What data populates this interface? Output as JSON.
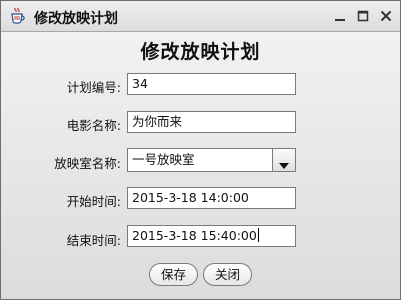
{
  "window": {
    "title": "修改放映计划"
  },
  "heading": "修改放映计划",
  "form": {
    "plan_id": {
      "label": "计划编号:",
      "value": "34"
    },
    "movie_name": {
      "label": "电影名称:",
      "value": "为你而来"
    },
    "hall_name": {
      "label": "放映室名称:",
      "value": "一号放映室"
    },
    "start_time": {
      "label": "开始时间:",
      "value": "2015-3-18 14:0:00"
    },
    "end_time": {
      "label": "结束时间:",
      "value": "2015-3-18 15:40:00"
    }
  },
  "buttons": {
    "save": "保存",
    "close": "关闭"
  },
  "icons": {
    "app": "java-coffee-cup-icon",
    "minimize": "minimize-icon",
    "maximize": "maximize-icon",
    "close": "close-icon",
    "dropdown": "chevron-down-icon"
  }
}
